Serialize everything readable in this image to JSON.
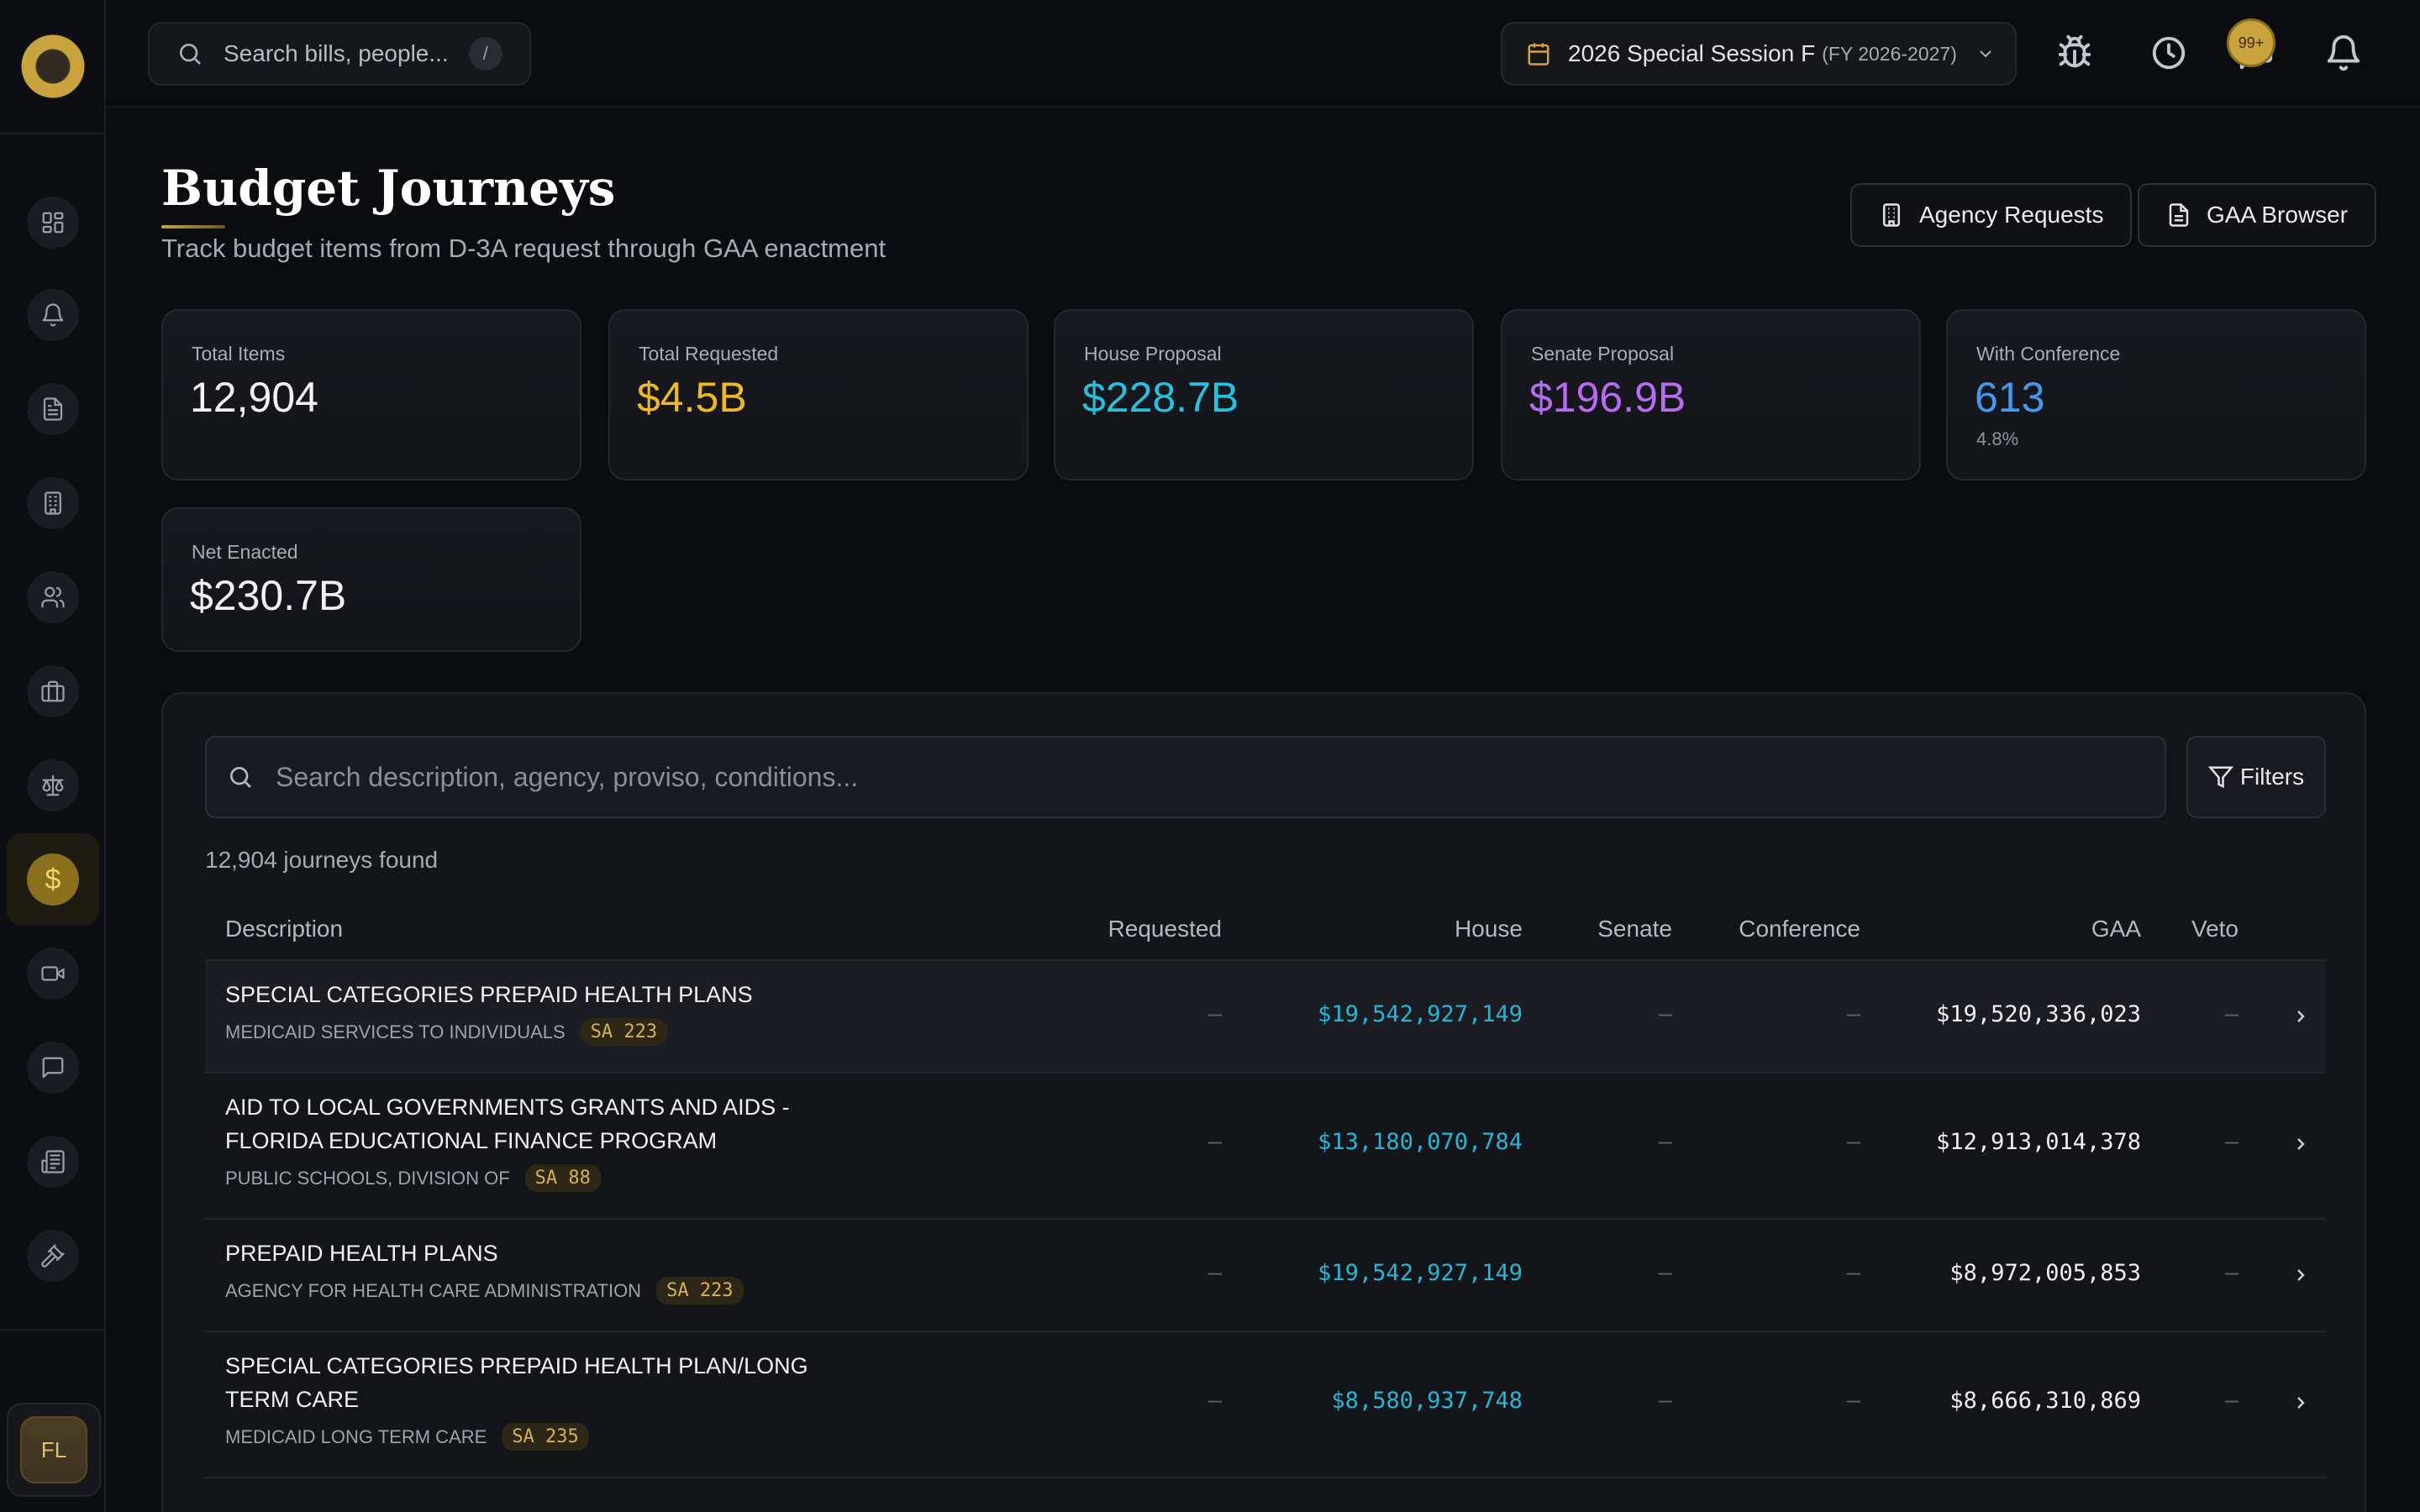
{
  "topbar": {
    "search_placeholder": "Search bills, people...",
    "search_shortcut": "/",
    "session_title": "2026 Special Session F",
    "session_fy": "(FY 2026-2027)",
    "notification_count": "99+"
  },
  "header": {
    "title": "Budget Journeys",
    "subtitle": "Track budget items from D-3A request through GAA enactment",
    "agency_requests_label": "Agency Requests",
    "gaa_browser_label": "GAA Browser"
  },
  "stats": [
    {
      "label": "Total Items",
      "value": "12,904",
      "color": "#f2f2f4"
    },
    {
      "label": "Total Requested",
      "value": "$4.5B",
      "color": "#f2b91e"
    },
    {
      "label": "House Proposal",
      "value": "$228.7B",
      "color": "#22c2e0"
    },
    {
      "label": "Senate Proposal",
      "value": "$196.9B",
      "color": "#b56cf2"
    },
    {
      "label": "With Conference",
      "value": "613",
      "sub": "4.8%",
      "color": "#3e9bf2"
    },
    {
      "label": "Net Enacted",
      "value": "$230.7B",
      "color": "#f2f2f4"
    }
  ],
  "main": {
    "search_placeholder": "Search description, agency, proviso, conditions...",
    "filters_label": "Filters",
    "found_text": "12,904 journeys found",
    "columns": [
      "Description",
      "Requested",
      "House",
      "Senate",
      "Conference",
      "GAA",
      "Veto"
    ],
    "rows": [
      {
        "description": "SPECIAL CATEGORIES PREPAID HEALTH PLANS",
        "agency": "MEDICAID SERVICES TO INDIVIDUALS",
        "sa": "SA 223",
        "requested": "—",
        "house": "$19,542,927,149",
        "senate": "—",
        "conference": "—",
        "gaa": "$19,520,336,023",
        "veto": "—"
      },
      {
        "description": "AID TO LOCAL GOVERNMENTS GRANTS AND AIDS - FLORIDA EDUCATIONAL FINANCE PROGRAM",
        "agency": "PUBLIC SCHOOLS, DIVISION OF",
        "sa": "SA 88",
        "requested": "—",
        "house": "$13,180,070,784",
        "senate": "—",
        "conference": "—",
        "gaa": "$12,913,014,378",
        "veto": "—"
      },
      {
        "description": "PREPAID HEALTH PLANS",
        "agency": "AGENCY FOR HEALTH CARE ADMINISTRATION",
        "sa": "SA 223",
        "requested": "—",
        "house": "$19,542,927,149",
        "senate": "—",
        "conference": "—",
        "gaa": "$8,972,005,853",
        "veto": "—"
      },
      {
        "description": "SPECIAL CATEGORIES PREPAID HEALTH PLAN/LONG TERM CARE",
        "agency": "MEDICAID LONG TERM CARE",
        "sa": "SA 235",
        "requested": "—",
        "house": "$8,580,937,748",
        "senate": "—",
        "conference": "—",
        "gaa": "$8,666,310,869",
        "veto": "—"
      }
    ]
  },
  "user": {
    "initials": "FL"
  }
}
